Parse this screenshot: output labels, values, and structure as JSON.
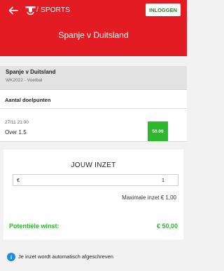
{
  "header": {
    "brand": "/ SPORTS",
    "login_label": "INLOGGEN",
    "title": "Spanje v Duitsland"
  },
  "event": {
    "title": "Spanje v Duitsland",
    "subtitle": "WK2022 - Voetbal"
  },
  "market": {
    "title": "Aantal doelpunten",
    "selection_date": "27/11  21:00",
    "selection_name": "Over 1.5",
    "odds": "50.00"
  },
  "stake": {
    "title": "JOUW INZET",
    "currency": "€",
    "value": "1",
    "max_text": "Maximale inzet € 1,00",
    "potential_label": "Potentiële winst:",
    "potential_value": "€ 50,00"
  },
  "info": {
    "text": "Je inzet wordt automatisch afgeschreven"
  },
  "colors": {
    "brand_red": "#e31b23",
    "accent_green": "#2eb82e",
    "info_blue": "#1e88e5"
  },
  "icons": [
    "back-arrow-icon",
    "brand-logo-icon",
    "info-icon"
  ]
}
